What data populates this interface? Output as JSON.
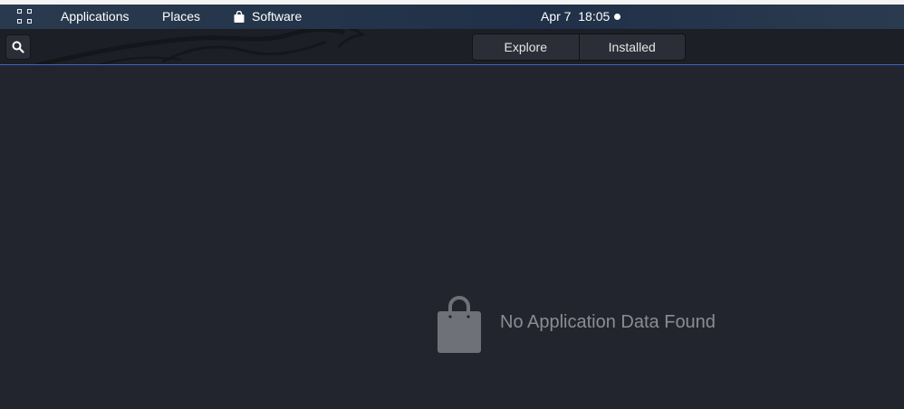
{
  "top_panel": {
    "activities_icon": "app-grid-icon",
    "applications_label": "Applications",
    "places_label": "Places",
    "software_icon": "shopping-bag-icon",
    "software_label": "Software",
    "clock": "Apr 7  18:05"
  },
  "header": {
    "search_icon": "search-icon",
    "tabs": [
      {
        "label": "Explore"
      },
      {
        "label": "Installed"
      }
    ]
  },
  "content": {
    "empty_icon": "shopping-bag-icon",
    "empty_message": "No Application Data Found"
  },
  "colors": {
    "background": "#23252e",
    "header": "#1d1f26",
    "accent_line": "#3a66c2",
    "muted_text": "#8b8d93"
  }
}
